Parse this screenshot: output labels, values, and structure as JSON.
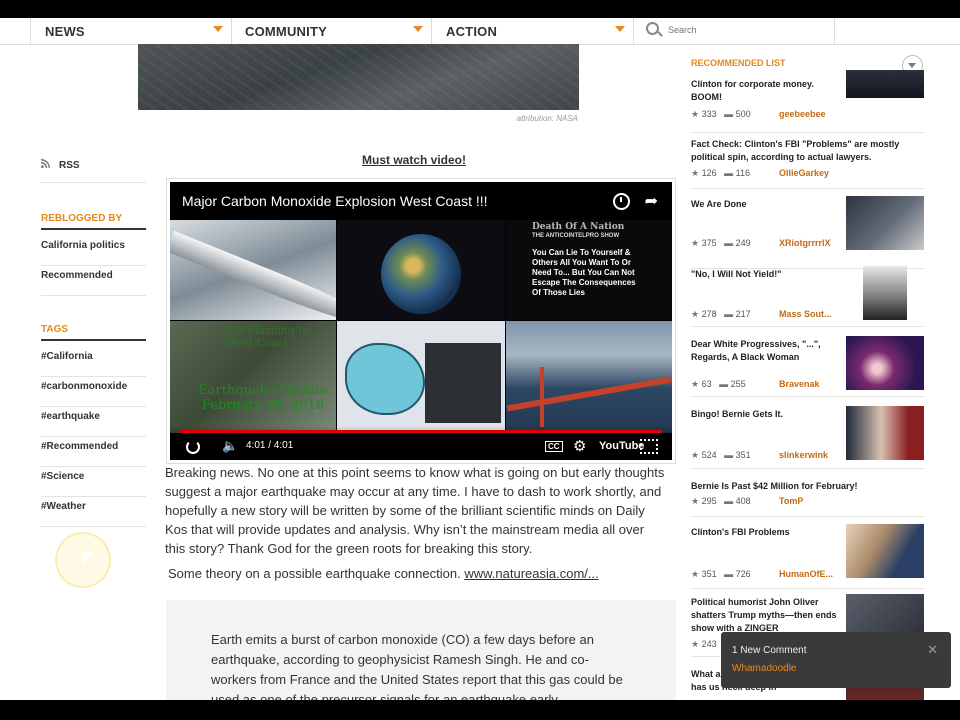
{
  "nav": {
    "items": [
      {
        "label": "NEWS"
      },
      {
        "label": "COMMUNITY"
      },
      {
        "label": "ACTION"
      }
    ],
    "search_placeholder": "Search"
  },
  "top_image": {
    "attribution": "attribution: NASA"
  },
  "sidebar": {
    "rss_label": "RSS",
    "reblogged_heading": "REBLOGGED BY",
    "reblogged": [
      "California politics",
      "Recommended"
    ],
    "tags_heading": "TAGS",
    "tags": [
      "#California",
      "#carbonmonoxide",
      "#earthquake",
      "#Recommended",
      "#Science",
      "#Weather"
    ]
  },
  "article": {
    "must_watch": "Must watch video!",
    "video": {
      "title": "Major Carbon Monoxide Explosion West Coast !!!",
      "time": "4:01 / 4:01",
      "thumb_death": "Death Of A Nation",
      "thumb_show": "THE ANTICOINTELPRO SHOW",
      "thumb_lie": "You Can Lie To Yourself & Others All You Want To Or Need To... But You Can Not Escape The Consequences Of Those Lies",
      "thumb_co": "CO Flashing in West Coast",
      "thumb_eq": "Earthquake Update February 28, 2016",
      "yt_label": "YouTube"
    },
    "paragraph1": "Breaking news. No one at this point seems to know what is going on but early thoughts suggest a major earthquake may occur at any time. I have to dash to work shortly, and hopefully a new story will be written by some of the brilliant scientific minds on Daily Kos that will provide updates and analysis. Why isn’t the mainstream media all over this story? Thank God for the green roots for breaking this story.",
    "paragraph2_prefix": "Some theory on a possible earthquake connection.",
    "paragraph2_link": "www.natureasia.com/...",
    "quote": "Earth emits a burst of carbon monoxide (CO) a few days before an earthquake, according to geophysicist Ramesh Singh. He and co-workers from France and the United States report that this gas could be used as one of the precursor signals for an earthquake early"
  },
  "recommended": {
    "heading": "RECOMMENDED LIST",
    "items": [
      {
        "title": "Clinton for corporate money. BOOM!",
        "recs": "333",
        "comments": "500",
        "author": "geebeebee"
      },
      {
        "title": "Fact Check: Clinton's FBI \"Problems\" are mostly political spin, according to actual lawyers.",
        "recs": "126",
        "comments": "116",
        "author": "OllieGarkey"
      },
      {
        "title": "We Are Done",
        "recs": "375",
        "comments": "249",
        "author": "XRiotgrrrrlX"
      },
      {
        "title": "\"No, I Will Not Yield!\"",
        "recs": "278",
        "comments": "217",
        "author": "Mass Sout..."
      },
      {
        "title": "Dear White Progressives, \"...\", Regards, A Black Woman",
        "recs": "63",
        "comments": "255",
        "author": "Bravenak"
      },
      {
        "title": "Bingo! Bernie Gets It.",
        "recs": "524",
        "comments": "351",
        "author": "slinkerwink"
      },
      {
        "title": "Bernie Is Past $42 Million for February!",
        "recs": "295",
        "comments": "408",
        "author": "TomP"
      },
      {
        "title": "Clinton's FBI Problems",
        "recs": "351",
        "comments": "726",
        "author": "HumanOfE..."
      },
      {
        "title": "Political humorist John Oliver shatters Trump myths—then ends show with a ZINGER",
        "recs": "243",
        "comments": "",
        "author": ""
      },
      {
        "title": "What are the odds Hillary Clinton has us neck deep in",
        "recs": "",
        "comments": "",
        "author": ""
      }
    ]
  },
  "notification": {
    "title": "1 New Comment",
    "author": "Whamadoodle",
    "close": "✕"
  },
  "icons": {
    "rss": "rss-icon",
    "star": "★",
    "comment": "💬",
    "search": "search-icon"
  },
  "colors": {
    "accent": "#e48a1b",
    "author": "#c46a12",
    "toast_bg": "#3a3a3a"
  }
}
